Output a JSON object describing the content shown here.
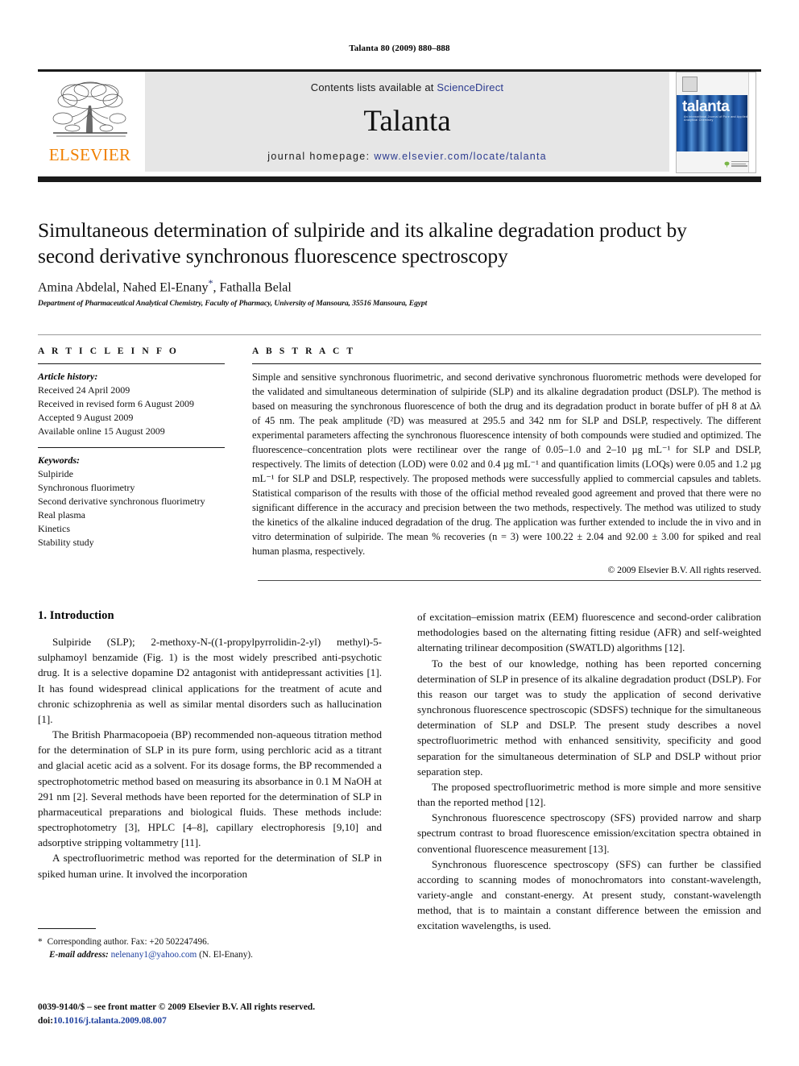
{
  "running_head": "Talanta 80 (2009) 880–888",
  "masthead": {
    "publisher_logo_label": "ELSEVIER",
    "contents_prefix": "Contents lists available at ",
    "sciencedirect_link": "ScienceDirect",
    "journal_name": "Talanta",
    "homepage_prefix": "journal homepage:",
    "homepage_url": "www.elsevier.com/locate/talanta",
    "cover_title": "talanta",
    "cover_subtitle": "An International Journal of Pure and Applied Analytical Chemistry"
  },
  "article": {
    "title": "Simultaneous determination of sulpiride and its alkaline degradation product by second derivative synchronous fluorescence spectroscopy",
    "authors": "Amina Abdelal, Nahed El-Enany",
    "authors_tail": ", Fathalla Belal",
    "corresponding_marker": "*",
    "affiliation": "Department of Pharmaceutical Analytical Chemistry, Faculty of Pharmacy, University of Mansoura, 35516 Mansoura, Egypt"
  },
  "article_info": {
    "label": "A R T I C L E    I N F O",
    "history_heading": "Article history:",
    "history": [
      "Received 24 April 2009",
      "Received in revised form 6 August 2009",
      "Accepted 9 August 2009",
      "Available online 15 August 2009"
    ],
    "keywords_heading": "Keywords:",
    "keywords": [
      "Sulpiride",
      "Synchronous fluorimetry",
      "Second derivative synchronous fluorimetry",
      "Real plasma",
      "Kinetics",
      "Stability study"
    ]
  },
  "abstract": {
    "label": "A B S T R A C T",
    "text": "Simple and sensitive synchronous fluorimetric, and second derivative synchronous fluorometric methods were developed for the validated and simultaneous determination of sulpiride (SLP) and its alkaline degradation product (DSLP). The method is based on measuring the synchronous fluorescence of both the drug and its degradation product in borate buffer of pH 8 at Δλ of 45 nm. The peak amplitude (²D) was measured at 295.5 and 342 nm for SLP and DSLP, respectively. The different experimental parameters affecting the synchronous fluorescence intensity of both compounds were studied and optimized. The fluorescence–concentration plots were rectilinear over the range of 0.05–1.0 and 2–10 µg mL⁻¹ for SLP and DSLP, respectively. The limits of detection (LOD) were 0.02 and 0.4 µg mL⁻¹ and quantification limits (LOQs) were 0.05 and 1.2 µg mL⁻¹ for SLP and DSLP, respectively. The proposed methods were successfully applied to commercial capsules and tablets. Statistical comparison of the results with those of the official method revealed good agreement and proved that there were no significant difference in the accuracy and precision between the two methods, respectively. The method was utilized to study the kinetics of the alkaline induced degradation of the drug. The application was further extended to include the in vivo and in vitro determination of sulpiride. The mean % recoveries (n = 3) were 100.22 ± 2.04 and 92.00 ± 3.00 for spiked and real human plasma, respectively.",
    "copyright": "© 2009 Elsevier B.V. All rights reserved."
  },
  "body": {
    "section_heading": "1. Introduction",
    "left_paragraphs": [
      "Sulpiride (SLP); 2-methoxy-N-((1-propylpyrrolidin-2-yl) methyl)-5-sulphamoyl benzamide (Fig. 1) is the most widely prescribed anti-psychotic drug. It is a selective dopamine D2 antagonist with antidepressant activities [1]. It has found widespread clinical applications for the treatment of acute and chronic schizophrenia as well as similar mental disorders such as hallucination [1].",
      "The British Pharmacopoeia (BP) recommended non-aqueous titration method for the determination of SLP in its pure form, using perchloric acid as a titrant and glacial acetic acid as a solvent. For its dosage forms, the BP recommended a spectrophotometric method based on measuring its absorbance in 0.1 M NaOH at 291 nm [2]. Several methods have been reported for the determination of SLP in pharmaceutical preparations and biological fluids. These methods include: spectrophotometry [3], HPLC [4–8], capillary electrophoresis [9,10] and adsorptive stripping voltammetry [11].",
      "A spectrofluorimetric method was reported for the determination of SLP in spiked human urine. It involved the incorporation"
    ],
    "right_paragraphs": [
      "of excitation–emission matrix (EEM) fluorescence and second-order calibration methodologies based on the alternating fitting residue (AFR) and self-weighted alternating trilinear decomposition (SWATLD) algorithms [12].",
      "To the best of our knowledge, nothing has been reported concerning determination of SLP in presence of its alkaline degradation product (DSLP). For this reason our target was to study the application of second derivative synchronous fluorescence spectroscopic (SDSFS) technique for the simultaneous determination of SLP and DSLP. The present study describes a novel spectrofluorimetric method with enhanced sensitivity, specificity and good separation for the simultaneous determination of SLP and DSLP without prior separation step.",
      "The proposed spectrofluorimetric method is more simple and more sensitive than the reported method [12].",
      "Synchronous fluorescence spectroscopy (SFS) provided narrow and sharp spectrum contrast to broad fluorescence emission/excitation spectra obtained in conventional fluorescence measurement [13].",
      "Synchronous fluorescence spectroscopy (SFS) can further be classified according to scanning modes of monochromators into constant-wavelength, variety-angle and constant-energy. At present study, constant-wavelength method, that is to maintain a constant difference between the emission and excitation wavelengths, is used."
    ]
  },
  "footnote": {
    "star": "*",
    "corresponding": "Corresponding author. Fax: +20 502247496.",
    "email_label": "E-mail address:",
    "email": "nelenany1@yahoo.com",
    "email_owner": "(N. El-Enany)."
  },
  "imprint": {
    "line1": "0039-9140/$ – see front matter © 2009 Elsevier B.V. All rights reserved.",
    "doi_label": "doi:",
    "doi": "10.1016/j.talanta.2009.08.007"
  },
  "colors": {
    "link": "#1d3f9e",
    "elsevier_orange": "#f08000",
    "sd_link": "#2b3a8f",
    "cover_blue": "#1b4f9c"
  }
}
